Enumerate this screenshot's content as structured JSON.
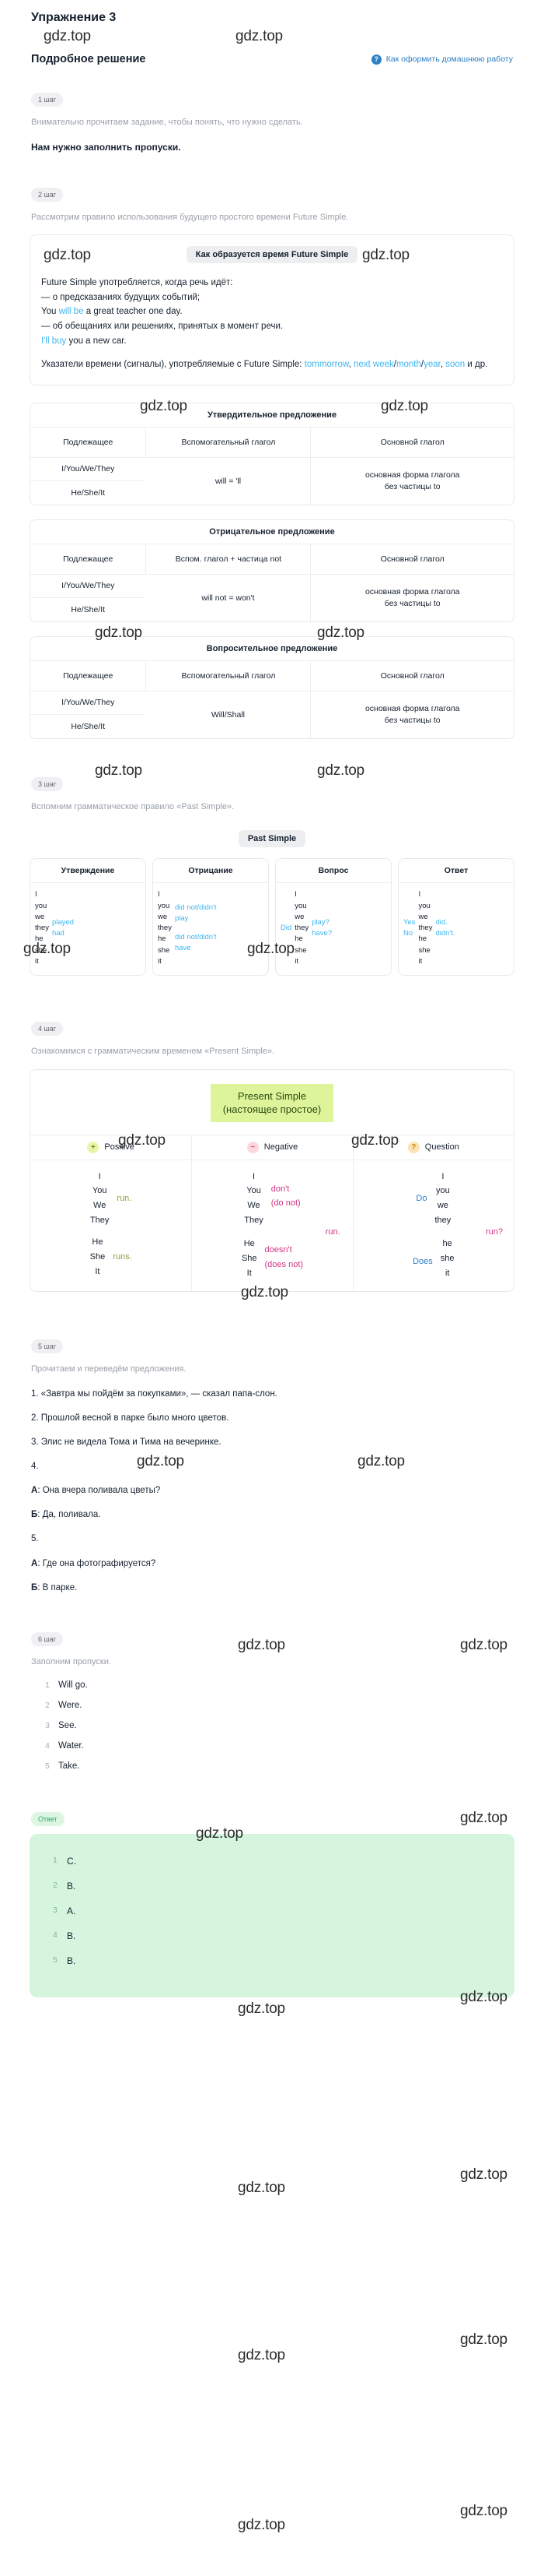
{
  "header": {
    "exercise_title": "Упражнение 3",
    "solution_title": "Подробное решение",
    "homework_link": "Как оформить домашнюю работу",
    "help_icon": "?"
  },
  "watermark": {
    "text": "gdz.top"
  },
  "steps": {
    "step1": {
      "badge": "1 шаг",
      "intro": "Внимательно прочитаем задание, чтобы понять, что нужно сделать.",
      "task": "Нам нужно заполнить пропуски."
    },
    "step2": {
      "badge": "2 шаг",
      "intro": "Рассмотрим правило использования будущего простого времени Future Simple."
    },
    "step3": {
      "badge": "3 шаг",
      "intro": "Вспомним грамматическое правило «Past Simple»."
    },
    "step4": {
      "badge": "4 шаг",
      "intro": "Ознакомимся с грамматическим временем «Present Simple»."
    },
    "step5": {
      "badge": "5 шаг",
      "intro": "Прочитаем и переведём предложения."
    },
    "step6": {
      "badge": "6 шаг",
      "intro": "Заполним пропуски."
    }
  },
  "future_rule": {
    "chip": "Как образуется время Future Simple",
    "line1": "Future Simple употребляется, когда речь идёт:",
    "line2": "— о предсказаниях будущих событий;",
    "ex1_pre": "You ",
    "ex1_hl": "will be",
    "ex1_post": " a great teacher one day.",
    "line3": "— об обещаниях или решениях, принятых в момент речи.",
    "ex2_hl": "I'll buy",
    "ex2_post": " you a new car.",
    "markers_pre": "Указатели времени (сигналы), употребляемые с Future Simple: ",
    "markers_hl1": "tommorrow",
    "markers_sep1": ", ",
    "markers_hl2": "next week",
    "markers_sep2": "/",
    "markers_hl3": "month",
    "markers_sep3": "/",
    "markers_hl4": "year",
    "markers_sep4": ", ",
    "markers_hl5": "soon",
    "markers_post": " и др."
  },
  "tables": [
    {
      "title": "Утвердительное предложение",
      "headers": [
        "Подлежащее",
        "Вспомогательный глагол",
        "Основной глагол"
      ],
      "subjects": [
        "I/You/We/They",
        "He/She/It"
      ],
      "aux": "will = 'll",
      "main_l1": "основная форма глагола",
      "main_l2": "без частицы to"
    },
    {
      "title": "Отрицательное предложение",
      "headers": [
        "Подлежащее",
        "Вспом. глагол + частица not",
        "Основной глагол"
      ],
      "subjects": [
        "I/You/We/They",
        "He/She/It"
      ],
      "aux": "will not = won't",
      "main_l1": "основная форма глагола",
      "main_l2": "без частицы to"
    },
    {
      "title": "Вопросительное предложение",
      "headers": [
        "Подлежащее",
        "Вспомогательный глагол",
        "Основной глагол"
      ],
      "subjects": [
        "I/You/We/They",
        "He/She/It"
      ],
      "aux": "Will/Shall",
      "main_l1": "основная форма глагола",
      "main_l2": "без частицы to"
    }
  ],
  "past_simple": {
    "chip": "Past Simple",
    "pronouns": [
      "I",
      "you",
      "we",
      "they",
      "he",
      "she",
      "it"
    ],
    "cards": [
      {
        "head": "Утверждение",
        "pre": "",
        "verb_top": "played",
        "verb_bottom": "had"
      },
      {
        "head": "Отрицание",
        "pre": "",
        "verb_top": "did not/didn't\nplay",
        "verb_bottom": "did not/didn't\nhave"
      },
      {
        "head": "Вопрос",
        "pre": "Did",
        "verb_top": "play?",
        "verb_bottom": "have?"
      },
      {
        "head": "Ответ",
        "pre": "Yes\nNo",
        "verb_top": "did.",
        "verb_bottom": "didn't."
      }
    ]
  },
  "present_simple": {
    "title_l1": "Present  Simple",
    "title_l2": "(настоящее простое)",
    "headers": [
      {
        "badge": "+",
        "label": "Positive",
        "icon": "plus-icon"
      },
      {
        "badge": "−",
        "label": "Negative",
        "icon": "minus-icon"
      },
      {
        "badge": "?",
        "label": "Question",
        "icon": "question-icon"
      }
    ],
    "positive": {
      "group1_pron": [
        "I",
        "You",
        "We",
        "They"
      ],
      "group1_verb": "run.",
      "group2_pron": [
        "He",
        "She",
        "It"
      ],
      "group2_verb": "runs."
    },
    "negative": {
      "group1_pron": [
        "I",
        "You",
        "We",
        "They"
      ],
      "group1_aux_l1": "don't",
      "group1_aux_l2": "(do not)",
      "group2_pron": [
        "He",
        "She",
        "It"
      ],
      "group2_aux_l1": "doesn't",
      "group2_aux_l2": "(does not)",
      "verb": "run."
    },
    "question": {
      "group1_aux": "Do",
      "group1_pron": [
        "I",
        "you",
        "we",
        "they"
      ],
      "group2_aux": "Does",
      "group2_pron": [
        "he",
        "she",
        "it"
      ],
      "verb": "run?"
    }
  },
  "translations": [
    {
      "num": "1.",
      "text": "«Завтра мы пойдём за покупками», — сказал папа-слон."
    },
    {
      "num": "2.",
      "text": "Прошлой весной в парке было много цветов."
    },
    {
      "num": "3.",
      "text": "Элис не видела Тома и Тима на вечеринке."
    },
    {
      "num": "4.",
      "text": ""
    },
    {
      "num": "",
      "speaker": "А",
      "text": ": Она вчера поливала цветы?"
    },
    {
      "num": "",
      "speaker": "Б",
      "text": ": Да, поливала."
    },
    {
      "num": "5.",
      "text": ""
    },
    {
      "num": "",
      "speaker": "А",
      "text": ": Где она фотографируется?"
    },
    {
      "num": "",
      "speaker": "Б",
      "text": ": В парке."
    }
  ],
  "fill_blanks": [
    {
      "num": "1",
      "text": "Will go."
    },
    {
      "num": "2",
      "text": "Were."
    },
    {
      "num": "3",
      "text": "See."
    },
    {
      "num": "4",
      "text": "Water."
    },
    {
      "num": "5",
      "text": "Take."
    }
  ],
  "answer": {
    "badge": "Ответ",
    "items": [
      {
        "num": "1",
        "value": "C."
      },
      {
        "num": "2",
        "value": "B."
      },
      {
        "num": "3",
        "value": "A."
      },
      {
        "num": "4",
        "value": "B."
      },
      {
        "num": "5",
        "value": "B."
      }
    ]
  }
}
